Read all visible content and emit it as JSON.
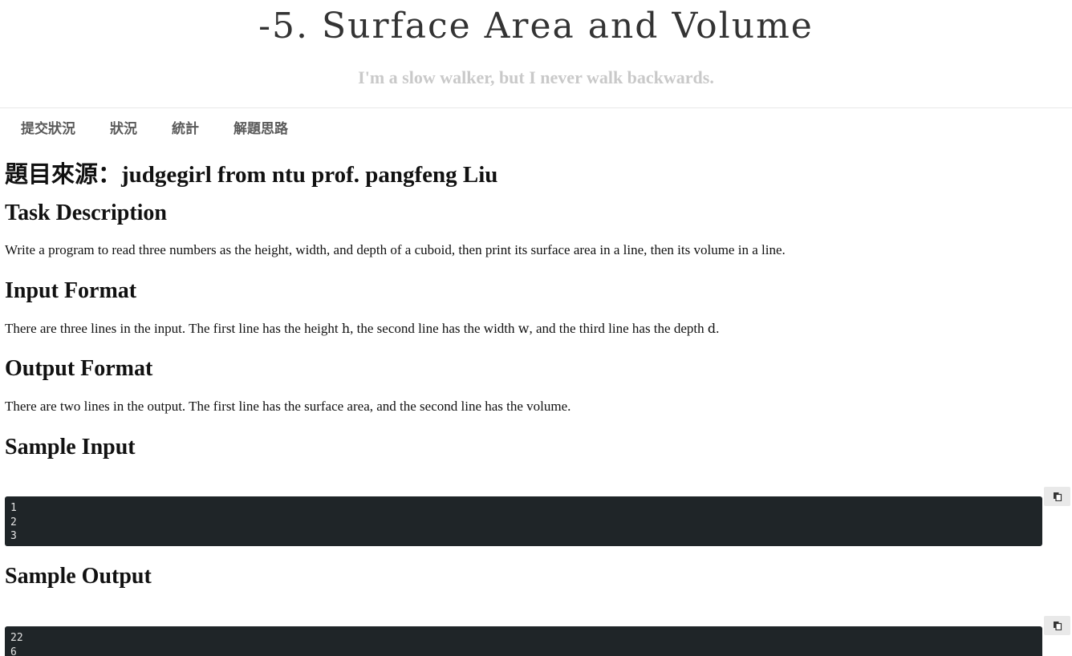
{
  "header": {
    "title": "-5. Surface Area and Volume",
    "subtitle": "I'm a slow walker, but I never walk backwards."
  },
  "nav": {
    "items": [
      {
        "label": "提交狀況"
      },
      {
        "label": "狀況"
      },
      {
        "label": "統計"
      },
      {
        "label": "解題思路"
      }
    ]
  },
  "content": {
    "source": "題目來源：judgegirl from ntu prof. pangfeng Liu",
    "task_heading": "Task Description",
    "task_text": "Write a program to read three numbers as the height, width, and depth of a cuboid, then print its surface area in a line, then its volume in a line.",
    "input_heading": "Input Format",
    "input_text_1": "There are three lines in the input. The first line has the height ",
    "input_var_h": "h",
    "input_text_2": ", the second line has the width ",
    "input_var_w": "w",
    "input_text_3": ", and the third line has the depth ",
    "input_var_d": "d",
    "input_text_4": ".",
    "output_heading": "Output Format",
    "output_text": "There are two lines in the output. The first line has the surface area, and the second line has the volume.",
    "sample_input_heading": "Sample Input",
    "sample_input_code": "1\n2\n3",
    "sample_output_heading": "Sample Output",
    "sample_output_code": "22\n6"
  },
  "icons": {
    "copy": "copy-icon"
  },
  "colors": {
    "code_bg": "#1f2528",
    "subtitle": "#c9c9c9"
  }
}
